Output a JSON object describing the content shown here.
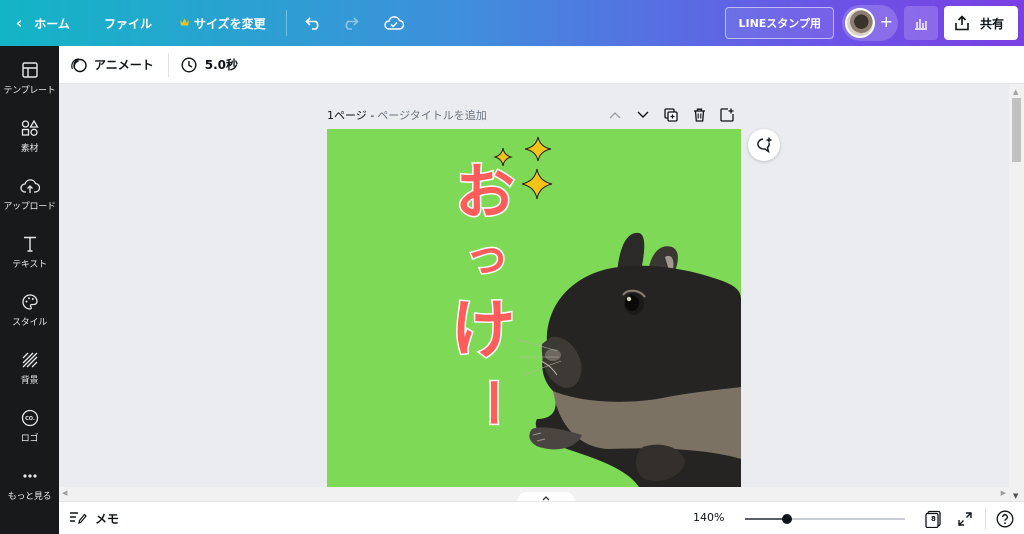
{
  "topbar": {
    "home_label": "ホーム",
    "file_label": "ファイル",
    "resize_label": "サイズを変更",
    "line_button_label": "LINEスタンプ用",
    "share_label": "共有"
  },
  "sidebar": {
    "items": [
      {
        "label": "テンプレート",
        "icon": "template-icon"
      },
      {
        "label": "素材",
        "icon": "elements-icon"
      },
      {
        "label": "アップロード",
        "icon": "upload-icon"
      },
      {
        "label": "テキスト",
        "icon": "text-icon"
      },
      {
        "label": "スタイル",
        "icon": "palette-icon"
      },
      {
        "label": "背景",
        "icon": "background-icon"
      },
      {
        "label": "ロゴ",
        "icon": "logo-icon"
      },
      {
        "label": "もっと見る",
        "icon": "more-icon"
      }
    ]
  },
  "toolbar": {
    "animate_label": "アニメート",
    "duration_label": "5.0秒"
  },
  "page": {
    "number_label": "1ページ -",
    "title_placeholder": "ページタイトルを追加"
  },
  "canvas": {
    "background_color": "#7ed956",
    "text_chars": [
      "お",
      "っ",
      "け",
      "ー"
    ],
    "text_color": "#ff5c5c",
    "sparkle_color": "#f5c218"
  },
  "bottombar": {
    "memo_label": "メモ",
    "zoom_label": "140%",
    "zoom_fraction": 0.26,
    "page_count": "8"
  },
  "colors": {
    "topbar_start": "#13b5c5",
    "topbar_end": "#7b3fe4",
    "sidebar_bg": "#18191b"
  }
}
